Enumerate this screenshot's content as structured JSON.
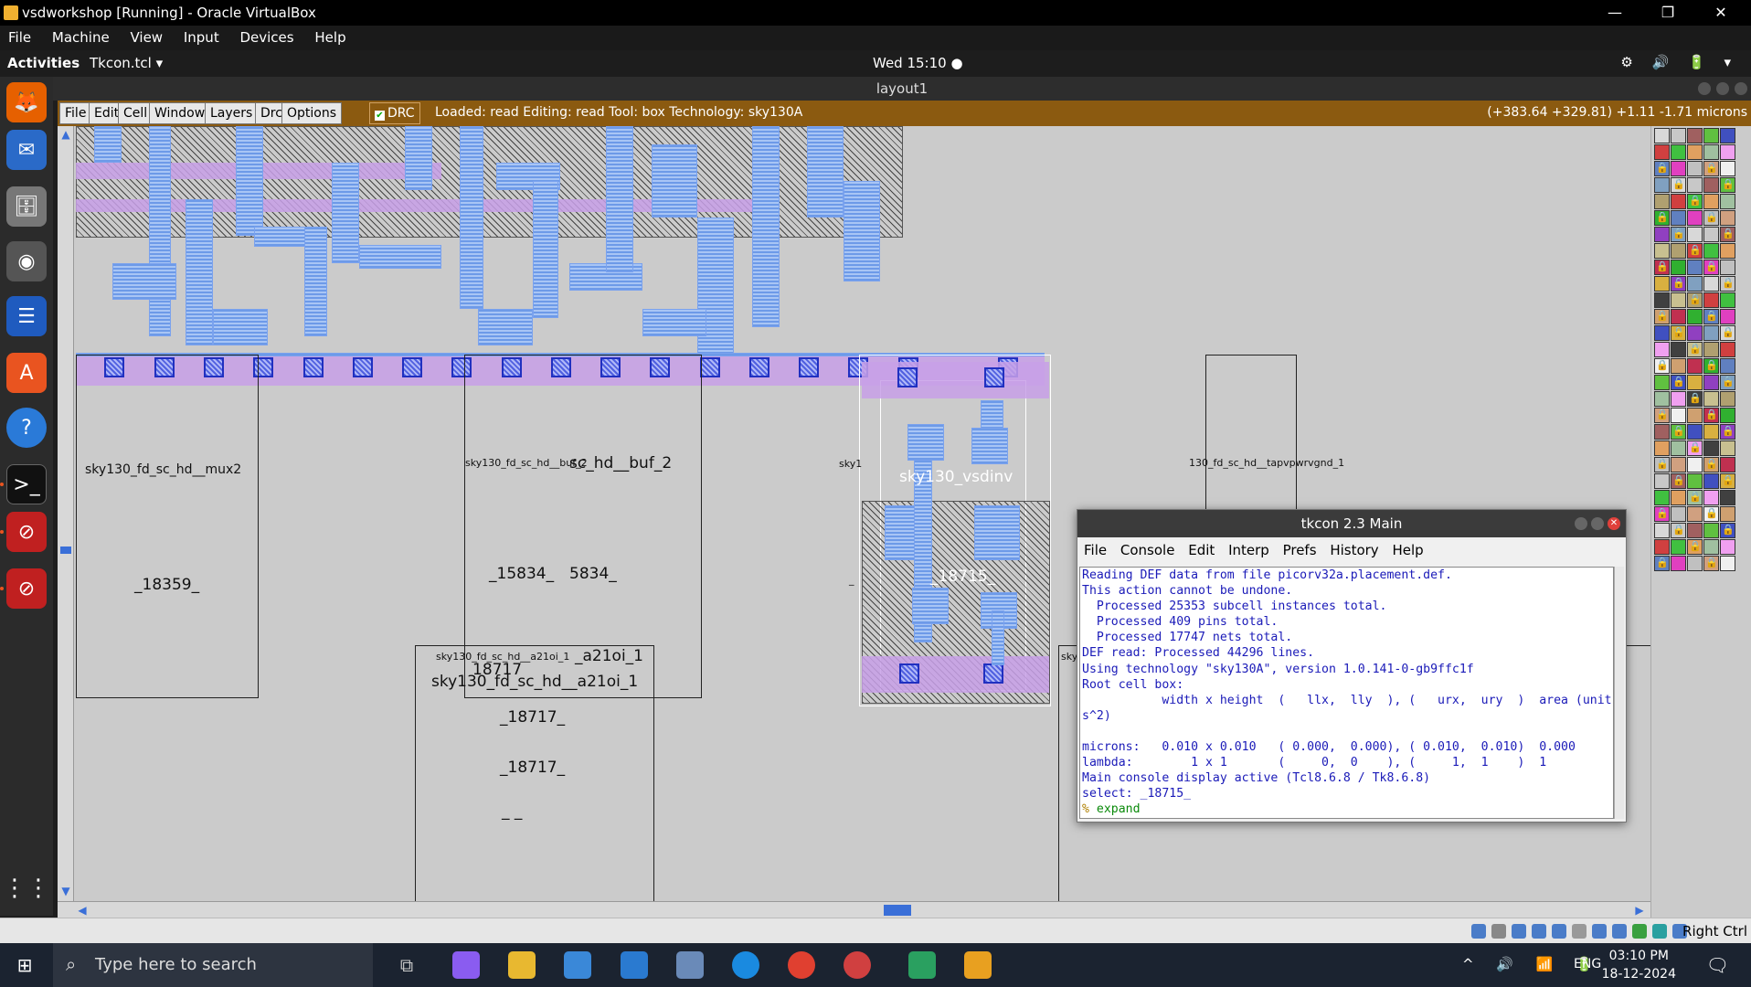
{
  "host_window": {
    "title": "vsdworkshop [Running] - Oracle VirtualBox",
    "menu": [
      "File",
      "Machine",
      "View",
      "Input",
      "Devices",
      "Help"
    ],
    "buttons": {
      "minimize": "—",
      "restore": "❐",
      "close": "✕"
    }
  },
  "gnome_bar": {
    "activities": "Activities",
    "app_menu": "Tkcon.tcl ▾",
    "clock": "Wed 15:10 ●"
  },
  "magic": {
    "window_title": "layout1",
    "menu": [
      "File",
      "Edit",
      "Cell",
      "Window",
      "Layers",
      "Drc",
      "Options"
    ],
    "drc_label": "DRC",
    "status": "Loaded: read Editing: read Tool: box  Technology: sky130A",
    "coords": "(+383.64 +329.81) +1.11 -1.71 microns"
  },
  "layout": {
    "cells": [
      {
        "name": "sky130_fd_sc_hd__mux2",
        "instance": "_18359_"
      },
      {
        "name": "sky130_fd_sc_hd__buf_2",
        "label_big": "sc_hd__buf_2",
        "instance": "_15834_",
        "instance2": "5834_"
      },
      {
        "name": "sky130_fd_sc_hd__a21oi_1",
        "label_big": "sky130_fd_sc_hd__a21oi_1",
        "frag": "_a21oi_1",
        "inst_overlap": "18717",
        "inst1": "_18717_",
        "inst2": "_18717_",
        "inst3": "_         _"
      },
      {
        "name": "sky130_vsdinv",
        "instance": "_18715_",
        "stub": "sky1"
      },
      {
        "name": "130_fd_sc_hd__tapvpwrvgnd_1"
      }
    ],
    "left_stub": "_",
    "right_stub": "sky",
    "right_under": "_         _"
  },
  "tkcon": {
    "title": "tkcon 2.3 Main",
    "menu": [
      "File",
      "Console",
      "Edit",
      "Interp",
      "Prefs",
      "History",
      "Help"
    ],
    "lines": [
      "Reading DEF data from file picorv32a.placement.def.",
      "This action cannot be undone.",
      "  Processed 25353 subcell instances total.",
      "  Processed 409 pins total.",
      "  Processed 17747 nets total.",
      "DEF read: Processed 44296 lines.",
      "Using technology \"sky130A\", version 1.0.141-0-gb9ffc1f",
      "Root cell box:",
      "           width x height  (   llx,  lly  ), (   urx,  ury  )  area (unit",
      "s^2)",
      "",
      "microns:   0.010 x 0.010   ( 0.000,  0.000), ( 0.010,  0.010)  0.000",
      "lambda:        1 x 1       (     0,  0    ), (     1,  1    )  1",
      "Main console display active (Tcl8.6.8 / Tk8.6.8)",
      "select: _18715_"
    ],
    "prompt": "% ",
    "command": "expand"
  },
  "vbox_status": {
    "host_key": "Right Ctrl"
  },
  "taskbar": {
    "search_placeholder": "Type here to search",
    "time": "03:10 PM",
    "date": "18-12-2024",
    "lang": "ENG"
  }
}
